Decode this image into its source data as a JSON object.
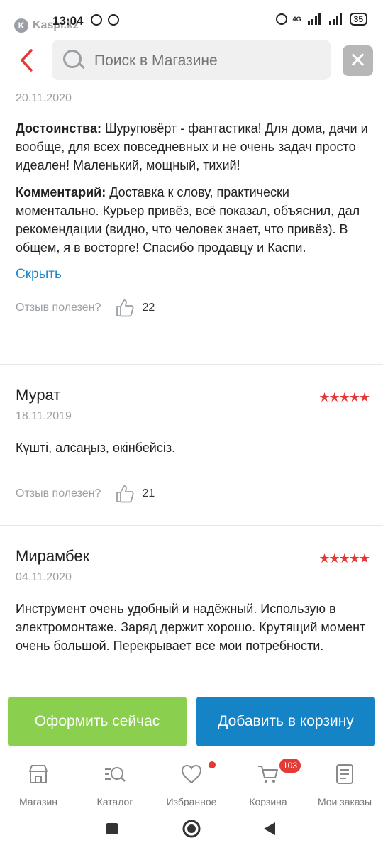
{
  "status_bar": {
    "app_name": "Kaspi.kz",
    "time": "13:04",
    "network": "4G",
    "battery": "35"
  },
  "search": {
    "placeholder": "Поиск в Магазине"
  },
  "reviews": [
    {
      "date": "20.11.2020",
      "pros_label": "Достоинства:",
      "pros": "Шуруповёрт - фантастика! Для дома, дачи и вообще, для всех повседневных и не очень задач просто идеален! Маленький, мощный, тихий!",
      "comment_label": "Комментарий:",
      "comment": "Доставка к слову, практически моментально. Курьер привёз, всё показал, объяснил, дал рекомендации (видно, что человек знает, что привёз). В общем, я в восторге! Спасибо продавцу и Каспи.",
      "hide_label": "Скрыть",
      "helpful_label": "Отзыв полезен?",
      "helpful_count": "22"
    },
    {
      "author": "Мурат",
      "date": "18.11.2019",
      "rating": 5,
      "text": "Күшті, алсаңыз, өкінбейсіз.",
      "helpful_label": "Отзыв полезен?",
      "helpful_count": "21"
    },
    {
      "author": "Мирамбек",
      "date": "04.11.2020",
      "rating": 5,
      "text": "Инструмент очень удобный и надёжный. Использую в электромонтаже. Заряд держит хорошо. Крутящий момент очень большой. Перекрывает все мои потребности."
    }
  ],
  "actions": {
    "buy_now": "Оформить сейчас",
    "add_to_cart": "Добавить в корзину"
  },
  "tabs": [
    {
      "label": "Магазин",
      "icon": "store-icon"
    },
    {
      "label": "Каталог",
      "icon": "catalog-search-icon"
    },
    {
      "label": "Избранное",
      "icon": "heart-icon"
    },
    {
      "label": "Корзина",
      "icon": "cart-icon",
      "badge": "103"
    },
    {
      "label": "Мои заказы",
      "icon": "orders-icon"
    }
  ],
  "colors": {
    "accent_red": "#e53935",
    "link_blue": "#1e88c8",
    "buy_green": "#8bcf4e",
    "cart_blue": "#1584c7"
  }
}
